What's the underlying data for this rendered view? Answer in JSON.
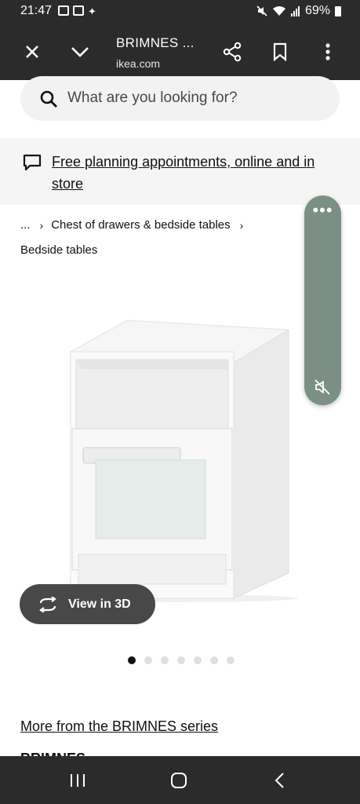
{
  "status": {
    "time": "21:47",
    "battery": "69%"
  },
  "tab": {
    "title": "BRIMNES ...",
    "url": "ikea.com"
  },
  "search": {
    "placeholder": "What are you looking for?"
  },
  "banner": {
    "text": "Free planning appointments, online and in store"
  },
  "breadcrumb": {
    "ellipsis": "...",
    "category": "Chest of drawers & bedside tables",
    "current": "Bedside tables"
  },
  "view3d": {
    "label": "View in 3D"
  },
  "carousel": {
    "total": 7,
    "active": 0
  },
  "links": {
    "more_series": "More from the BRIMNES series",
    "peek": "BRIMNES"
  },
  "colors": {
    "dark_bar": "#2b2b2b",
    "float_panel": "#7b8f85",
    "view3d_bg": "#484848"
  }
}
